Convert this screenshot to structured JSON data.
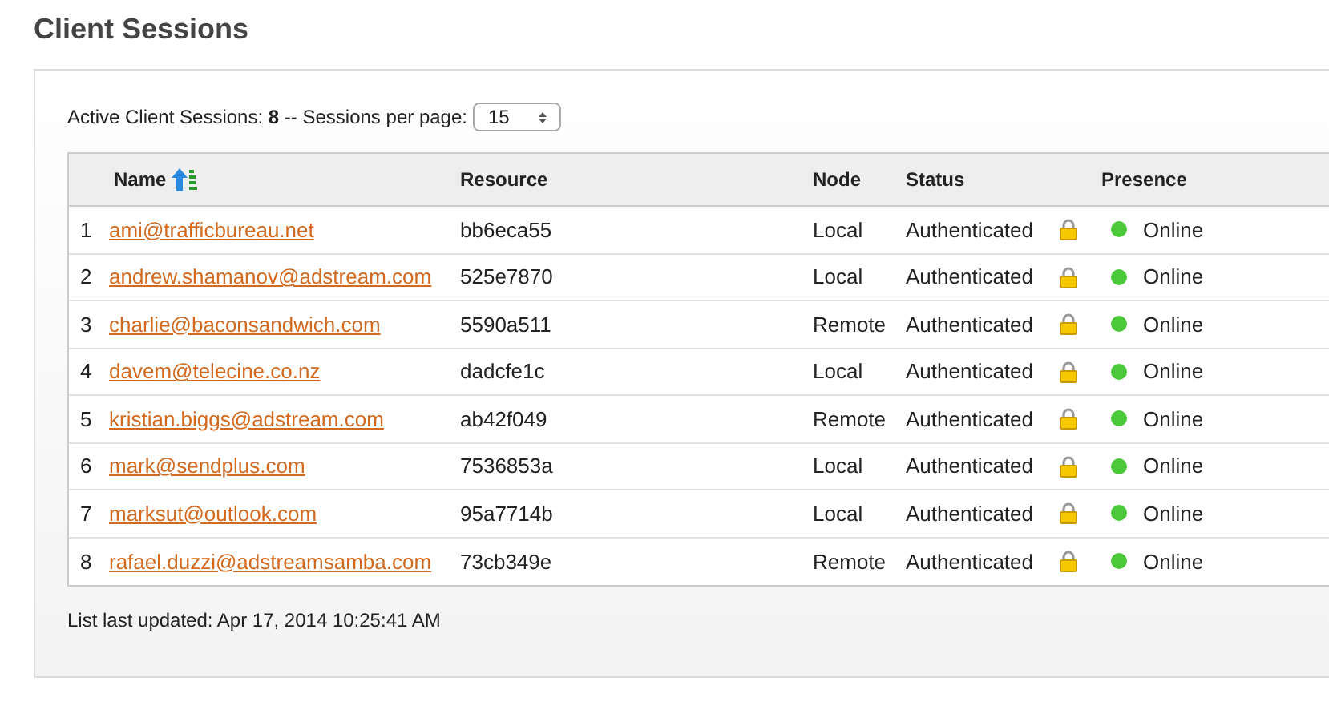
{
  "title": "Client Sessions",
  "summary": {
    "label": "Active Client Sessions:",
    "count": "8",
    "separator": "-- Sessions per page:",
    "per_page": "15"
  },
  "table": {
    "columns": [
      {
        "label": "Name",
        "sorted": true
      },
      {
        "label": "Resource",
        "sorted": false
      },
      {
        "label": "Node",
        "sorted": false
      },
      {
        "label": "Status",
        "sorted": false
      },
      {
        "label": "Presence",
        "sorted": false
      }
    ],
    "rows": [
      {
        "index": "1",
        "name": "ami@trafficbureau.net",
        "resource": "bb6eca55",
        "node": "Local",
        "status": "Authenticated",
        "presence": "Online"
      },
      {
        "index": "2",
        "name": "andrew.shamanov@adstream.com",
        "resource": "525e7870",
        "node": "Local",
        "status": "Authenticated",
        "presence": "Online"
      },
      {
        "index": "3",
        "name": "charlie@baconsandwich.com",
        "resource": "5590a511",
        "node": "Remote",
        "status": "Authenticated",
        "presence": "Online"
      },
      {
        "index": "4",
        "name": "davem@telecine.co.nz",
        "resource": "dadcfe1c",
        "node": "Local",
        "status": "Authenticated",
        "presence": "Online"
      },
      {
        "index": "5",
        "name": "kristian.biggs@adstream.com",
        "resource": "ab42f049",
        "node": "Remote",
        "status": "Authenticated",
        "presence": "Online"
      },
      {
        "index": "6",
        "name": "mark@sendplus.com",
        "resource": "7536853a",
        "node": "Local",
        "status": "Authenticated",
        "presence": "Online"
      },
      {
        "index": "7",
        "name": "marksut@outlook.com",
        "resource": "95a7714b",
        "node": "Local",
        "status": "Authenticated",
        "presence": "Online"
      },
      {
        "index": "8",
        "name": "rafael.duzzi@adstreamsamba.com",
        "resource": "73cb349e",
        "node": "Remote",
        "status": "Authenticated",
        "presence": "Online"
      }
    ]
  },
  "footer": "List last updated: Apr 17, 2014 10:25:41 AM"
}
